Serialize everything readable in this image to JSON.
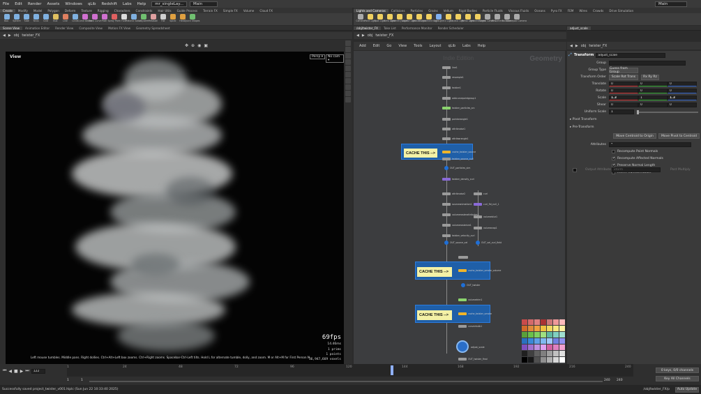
{
  "menubar": {
    "items": [
      "File",
      "Edit",
      "Render",
      "Assets",
      "Windows",
      "qLib",
      "Redshift",
      "Labs",
      "Help"
    ],
    "scene_file": "mr_singleLay...",
    "desktop": "Main",
    "right_desktop": "Main"
  },
  "shelf_tabs_left": [
    "Create",
    "Modify",
    "Model",
    "Polygon",
    "Deform",
    "Texture",
    "Rigging",
    "Characters",
    "Constraints",
    "Hair Utils",
    "Guide Process",
    "Terrain FX",
    "Simple FX",
    "Volume",
    "Cloud FX"
  ],
  "shelf_tabs_right": [
    "Lights and Cameras",
    "Collisions",
    "Particles",
    "Grains",
    "Vellum",
    "Rigid Bodies",
    "Particle Fluids",
    "Viscous Fluids",
    "Oceans",
    "Pyro FX",
    "FEM",
    "Wires",
    "Crowds",
    "Drive Simulation"
  ],
  "shelf_tools_left": [
    {
      "label": "Box",
      "color": "#7fb0e0"
    },
    {
      "label": "Sphere",
      "color": "#7fb0e0"
    },
    {
      "label": "Tube",
      "color": "#7fb0e0"
    },
    {
      "label": "Torus",
      "color": "#7fb0e0"
    },
    {
      "label": "Grid",
      "color": "#7fb0e0"
    },
    {
      "label": "Null",
      "color": "#e0c060"
    },
    {
      "label": "Line",
      "color": "#e08060"
    },
    {
      "label": "Circle",
      "color": "#7fb0e0"
    },
    {
      "label": "Curve Bezier",
      "color": "#d070d0"
    },
    {
      "label": "Draw Curve",
      "color": "#d070d0"
    },
    {
      "label": "Path",
      "color": "#d070d0"
    },
    {
      "label": "Spray Paint",
      "color": "#e06060"
    },
    {
      "label": "Font",
      "color": "#dddddd"
    },
    {
      "label": "Platonic Solids",
      "color": "#7fb0e0"
    },
    {
      "label": "L-System",
      "color": "#70c070"
    },
    {
      "label": "Metaball",
      "color": "#e0a0a0"
    },
    {
      "label": "File",
      "color": "#d0d0d0"
    },
    {
      "label": "Spiral",
      "color": "#e0a040"
    },
    {
      "label": "Helix",
      "color": "#e0a040"
    },
    {
      "label": "Quick Shapes",
      "color": "#70c070"
    }
  ],
  "shelf_tools_right": [
    {
      "label": "Camera",
      "color": "#aaaaaa"
    },
    {
      "label": "Point Light",
      "color": "#f0d060"
    },
    {
      "label": "Spot Light",
      "color": "#f0d060"
    },
    {
      "label": "Area Light",
      "color": "#f0d060"
    },
    {
      "label": "Geometry Light",
      "color": "#f0d060"
    },
    {
      "label": "Volume Light",
      "color": "#f0d060"
    },
    {
      "label": "Distant Light",
      "color": "#f0d060"
    },
    {
      "label": "Environment Light",
      "color": "#f0d060"
    },
    {
      "label": "Sky Light",
      "color": "#80b0f0"
    },
    {
      "label": "GI Light",
      "color": "#f0d060"
    },
    {
      "label": "Caustic Light",
      "color": "#f0d060"
    },
    {
      "label": "Portal Light",
      "color": "#f0d060"
    },
    {
      "label": "Ambient Light",
      "color": "#f0d060"
    },
    {
      "label": "Stereo Camera",
      "color": "#aaaaaa"
    },
    {
      "label": "VR Camera",
      "color": "#aaaaaa"
    },
    {
      "label": "Switcher",
      "color": "#aaaaaa"
    },
    {
      "label": "Gamepad Camera",
      "color": "#aaaaaa"
    }
  ],
  "left_pane_tabs": [
    "Scene View",
    "Animation Editor",
    "Render View",
    "Composite View",
    "Motion FX View",
    "Geometry Spreadsheet"
  ],
  "mid_pane_tabs": [
    "/obj/twister_FX",
    "Take List",
    "Performance Monitor",
    "Render Scheduler"
  ],
  "right_pane_tabs": [
    "adjust_scale"
  ],
  "viewport": {
    "path_obj": "obj",
    "path_node": "twister_FX",
    "view_label": "View",
    "persp": "Persp ▾",
    "cam": "No cam ▾",
    "fps": "69fps",
    "ms": "14.46ms",
    "prims": "1  prims",
    "points": "1  points",
    "voxels": "36,947,669  voxels",
    "status_hint": "Left mouse tumbles. Middle pans. Right dollies. Ctrl+Alt+Left box zooms. Ctrl+Right zooms. Spacebar-Ctrl-Left tilts. Hold L for alternate tumble, dolly, and zoom. M or Alt+M for First Person Navig"
  },
  "network": {
    "path_obj": "obj",
    "path_node": "twister_FX",
    "menu": [
      "Add",
      "Edit",
      "Go",
      "View",
      "Tools",
      "Layout",
      "qLib",
      "Labs",
      "Help"
    ],
    "watermark_edition": "Indie Edition",
    "watermark_context": "Geometry",
    "cache_notes": [
      "CACHE THIS -->",
      "CACHE THIS -->",
      "CACHE THIS -->"
    ],
    "node_labels": [
      "line1",
      "resample1",
      "twister1",
      "addcurvepointgroup1",
      "twister_particles_src",
      "pointwrangle1",
      "attribnoise1",
      "attribwrangle1",
      "cache_twister_source",
      "twister_source_null",
      "OUT_particles_sim",
      "twister_density_curl",
      "attribnoise2",
      "curl",
      "sourceanimation1",
      "curl_fld_null_1",
      "volumerasterattributes1",
      "volumeblur1",
      "volumerasterize1",
      "volumevop1",
      "twister_velocity_curl",
      "OUT_source_vel",
      "OUT_vel_curl_field",
      "cache_twister_smoke_volume",
      "OUT_twister",
      "cache_twister_smoke",
      "volumetrim1",
      "OUT_RENDER",
      "convertvdb1",
      "adjust_scale",
      "OUT_twister_final"
    ]
  },
  "params": {
    "node_type": "Transform",
    "node_name": "adjust_scale",
    "group_label": "Group",
    "group_value": "",
    "group_type_label": "Group Type",
    "group_type_value": "Guess from Group",
    "xform_order_label": "Transform Order",
    "xform_order_value": "Scale Rot Trans",
    "rot_order_value": "Rx Ry Rz",
    "translate_label": "Translate",
    "translate": [
      "0",
      "0",
      "0"
    ],
    "rotate_label": "Rotate",
    "rotate": [
      "0",
      "0",
      "0"
    ],
    "scale_label": "Scale",
    "scale": [
      "1.3",
      "1",
      "1.3"
    ],
    "shear_label": "Shear",
    "shear": [
      "0",
      "0",
      "0"
    ],
    "uniform_scale_label": "Uniform Scale",
    "uniform_scale": "1",
    "pivot_transform": "Pivot Transform",
    "pre_transform": "Pre-Transform",
    "move_centroid_origin": "Move Centroid to Origin",
    "move_pivot_centroid": "Move Pivot to Centroid",
    "attributes_label": "Attributes",
    "attributes_value": "*",
    "recompute_point_normals": "Recompute Point Normals",
    "recompute_affected_normals": "Recompute Affected Normals",
    "preserve_normal_length": "Preserve Normal Length",
    "invert_transformation": "Invert Transformation",
    "output_attribute_label": "Output Attribute",
    "output_attribute_value": "xform",
    "post_multiply": "Post Multiply"
  },
  "timeline": {
    "current_frame": "122",
    "ticks": [
      "1",
      "24",
      "48",
      "72",
      "96",
      "120",
      "144",
      "168",
      "192",
      "216",
      "240"
    ],
    "start_frame": "1",
    "start_frame2": "1",
    "end_frame": "240",
    "end_frame2": "240",
    "keys_info": "0 keys, 0/0 channels",
    "key_all_channels": "Key All Channels",
    "auto_update": "Auto Update",
    "path_display": "/obj/twister_FX/p"
  },
  "status": {
    "message": "Successfully saved project_twister_v001.hiplc (Sun Jun 22 10:33:40 2025)"
  },
  "palette_colors": [
    "#c94b4b",
    "#d46a6a",
    "#e08080",
    "#a33",
    "#c77",
    "#e99",
    "#fbb",
    "#d26a2a",
    "#e08a3a",
    "#f0a040",
    "#f0c040",
    "#f0d860",
    "#f8e880",
    "#fff0a0",
    "#5aa03a",
    "#6ac04a",
    "#80d060",
    "#a0e080",
    "#60b8a0",
    "#80d0c0",
    "#a0e0d0",
    "#2a70c0",
    "#3a88d8",
    "#60a0e8",
    "#80b8f0",
    "#a0c8f8",
    "#7080e0",
    "#9090f0",
    "#8050c0",
    "#a070d0",
    "#c090e0",
    "#e0a0f0",
    "#d060a0",
    "#e080c0",
    "#f0a0d0",
    "#202020",
    "#404040",
    "#606060",
    "#808080",
    "#a0a0a0",
    "#c0c0c0",
    "#e0e0e0",
    "#000000",
    "#181818",
    "#505050",
    "#909090",
    "#b0b0b0",
    "#d8d8d8",
    "#ffffff"
  ]
}
